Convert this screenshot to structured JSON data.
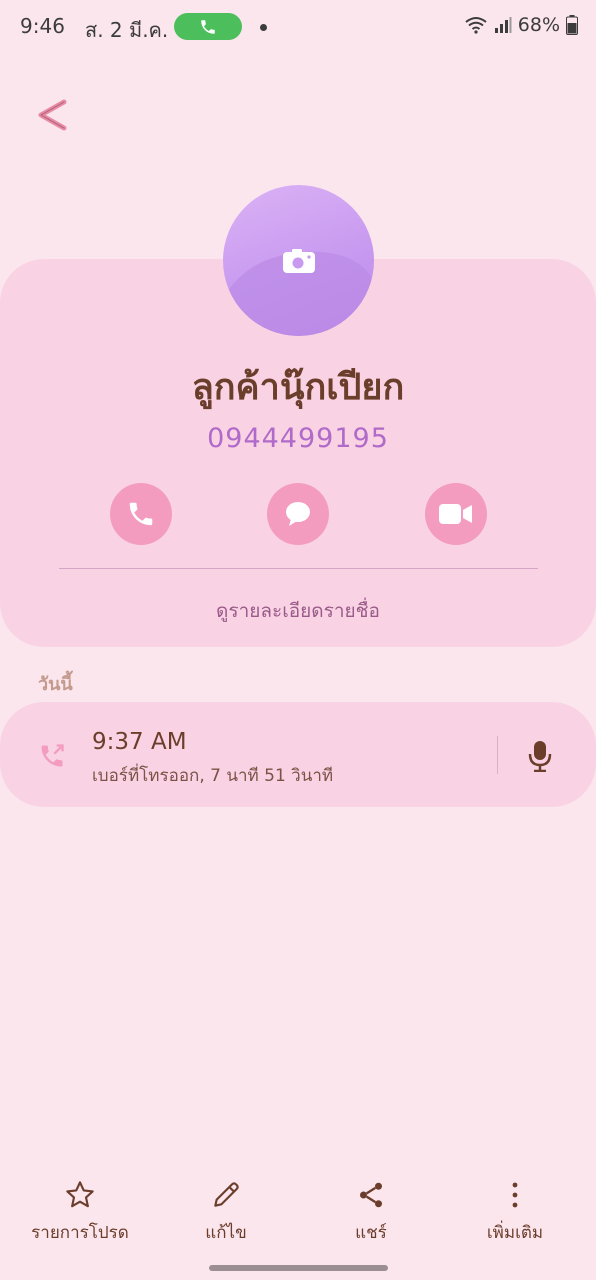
{
  "status_bar": {
    "time": "9:46",
    "date": "ส. 2 มี.ค.",
    "battery": "68%",
    "icons": [
      "phone-call-icon",
      "wifi-icon",
      "signal-icon",
      "battery-icon"
    ],
    "call_pill_color": "#4cbe5c"
  },
  "contact": {
    "name": "ลูกค้านุ๊กเปียก",
    "number": "0944499195",
    "view_details": "ดูรายละเอียดรายชื่อ",
    "actions": [
      "call",
      "message",
      "video-call"
    ]
  },
  "history": {
    "section_label": "วันนี้",
    "calls": [
      {
        "time": "9:37 AM",
        "detail": "เบอร์ที่โทรออก, 7 นาที 51 วินาที",
        "type": "outgoing"
      }
    ]
  },
  "bottom_nav": {
    "favorite": "รายการโปรด",
    "edit": "แก้ไข",
    "share": "แชร์",
    "more": "เพิ่มเติม"
  },
  "colors": {
    "background": "#fce6ee",
    "card": "#f9d3e3",
    "accent_pink": "#f39cc0",
    "number": "#b06ac9",
    "text_brown": "#6b3e2c"
  }
}
